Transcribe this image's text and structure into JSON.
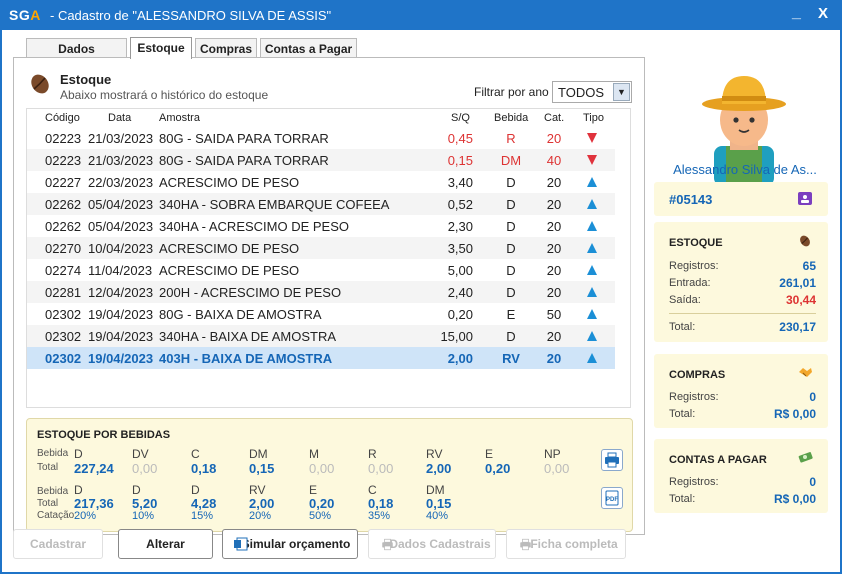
{
  "window": {
    "logo_main": "SG",
    "logo_accent": "A",
    "title": " - Cadastro de \"ALESSANDRO SILVA DE ASSIS\"",
    "minimize": "_",
    "close": "X"
  },
  "tabs": [
    {
      "label": "Dados cadastrais"
    },
    {
      "label": "Estoque",
      "active": true
    },
    {
      "label": "Compras"
    },
    {
      "label": "Contas a Pagar"
    }
  ],
  "estoque": {
    "title": "Estoque",
    "subtitle": "Abaixo mostrará o histórico do estoque",
    "filter_label": "Filtrar por ano",
    "filter_value": "TODOS"
  },
  "grid": {
    "columns": [
      "Código",
      "Data",
      "Amostra",
      "S/Q",
      "Bebida",
      "Cat.",
      "Tipo"
    ],
    "rows": [
      {
        "codigo": "02223",
        "data": "21/03/2023",
        "amostra": "80G - SAIDA PARA TORRAR",
        "sq": "0,45",
        "bebida": "R",
        "cat": "20",
        "tipo": "down"
      },
      {
        "codigo": "02223",
        "data": "21/03/2023",
        "amostra": "80G - SAIDA PARA TORRAR",
        "sq": "0,15",
        "bebida": "DM",
        "cat": "40",
        "tipo": "down"
      },
      {
        "codigo": "02227",
        "data": "22/03/2023",
        "amostra": "ACRESCIMO DE PESO",
        "sq": "3,40",
        "bebida": "D",
        "cat": "20",
        "tipo": "up"
      },
      {
        "codigo": "02262",
        "data": "05/04/2023",
        "amostra": "340HA - SOBRA EMBARQUE COFEEA",
        "sq": "0,52",
        "bebida": "D",
        "cat": "20",
        "tipo": "up"
      },
      {
        "codigo": "02262",
        "data": "05/04/2023",
        "amostra": "340HA - ACRESCIMO DE PESO",
        "sq": "2,30",
        "bebida": "D",
        "cat": "20",
        "tipo": "up"
      },
      {
        "codigo": "02270",
        "data": "10/04/2023",
        "amostra": "ACRESCIMO DE PESO",
        "sq": "3,50",
        "bebida": "D",
        "cat": "20",
        "tipo": "up"
      },
      {
        "codigo": "02274",
        "data": "11/04/2023",
        "amostra": "ACRESCIMO DE PESO",
        "sq": "5,00",
        "bebida": "D",
        "cat": "20",
        "tipo": "up"
      },
      {
        "codigo": "02281",
        "data": "12/04/2023",
        "amostra": "200H - ACRESCIMO DE PESO",
        "sq": "2,40",
        "bebida": "D",
        "cat": "20",
        "tipo": "up"
      },
      {
        "codigo": "02302",
        "data": "19/04/2023",
        "amostra": "80G - BAIXA DE AMOSTRA",
        "sq": "0,20",
        "bebida": "E",
        "cat": "50",
        "tipo": "up"
      },
      {
        "codigo": "02302",
        "data": "19/04/2023",
        "amostra": "340HA - BAIXA DE AMOSTRA",
        "sq": "15,00",
        "bebida": "D",
        "cat": "20",
        "tipo": "up"
      },
      {
        "codigo": "02302",
        "data": "19/04/2023",
        "amostra": "403H - BAIXA DE AMOSTRA",
        "sq": "2,00",
        "bebida": "RV",
        "cat": "20",
        "tipo": "up",
        "selected": true
      }
    ]
  },
  "bebidas": {
    "title": "ESTOQUE POR BEBIDAS",
    "row1_label_top": "Bebida",
    "row1_label_bottom": "Total",
    "row1": [
      {
        "h": "D",
        "v": "227,24",
        "muted": false
      },
      {
        "h": "DV",
        "v": "0,00",
        "muted": true
      },
      {
        "h": "C",
        "v": "0,18",
        "muted": false
      },
      {
        "h": "DM",
        "v": "0,15",
        "muted": false
      },
      {
        "h": "M",
        "v": "0,00",
        "muted": true
      },
      {
        "h": "R",
        "v": "0,00",
        "muted": true
      },
      {
        "h": "RV",
        "v": "2,00",
        "muted": false
      },
      {
        "h": "E",
        "v": "0,20",
        "muted": false
      },
      {
        "h": "NP",
        "v": "0,00",
        "muted": true
      }
    ],
    "row2_label_top": "Bebida",
    "row2_label_mid": "Total",
    "row2_label_bottom": "Catação",
    "row2": [
      {
        "h": "D",
        "v": "217,36",
        "p": "20%"
      },
      {
        "h": "D",
        "v": "5,20",
        "p": "10%"
      },
      {
        "h": "D",
        "v": "4,28",
        "p": "15%"
      },
      {
        "h": "RV",
        "v": "2,00",
        "p": "20%"
      },
      {
        "h": "E",
        "v": "0,20",
        "p": "50%"
      },
      {
        "h": "C",
        "v": "0,18",
        "p": "35%"
      },
      {
        "h": "DM",
        "v": "0,15",
        "p": "40%"
      }
    ]
  },
  "buttons": {
    "cadastrar": "Cadastrar",
    "alterar": "Alterar",
    "simular": "Simular orçamento",
    "dados": "Dados Cadastrais",
    "ficha": "Ficha completa"
  },
  "profile": {
    "name": "Alessandro Silva de As...",
    "id": "#05143"
  },
  "panel_estoque": {
    "title": "ESTOQUE",
    "registros_label": "Registros:",
    "registros": "65",
    "entrada_label": "Entrada:",
    "entrada": "261,01",
    "saida_label": "Saída:",
    "saida": "30,44",
    "total_label": "Total:",
    "total": "230,17"
  },
  "panel_compras": {
    "title": "COMPRAS",
    "registros_label": "Registros:",
    "registros": "0",
    "total_label": "Total:",
    "total": "R$ 0,00"
  },
  "panel_contas": {
    "title": "CONTAS A PAGAR",
    "registros_label": "Registros:",
    "registros": "0",
    "total_label": "Total:",
    "total": "R$ 0,00"
  }
}
